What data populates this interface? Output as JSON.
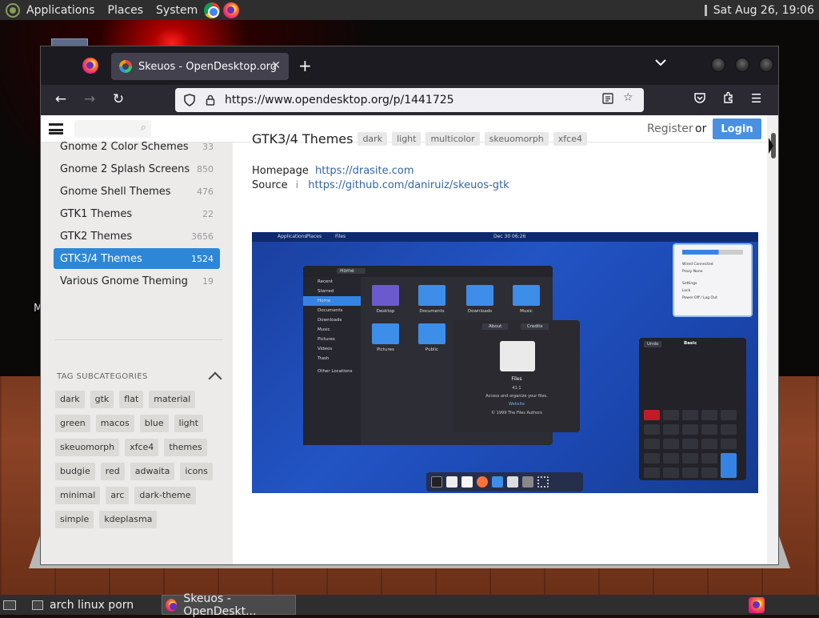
{
  "top_panel": {
    "menus": [
      "Applications",
      "Places",
      "System"
    ],
    "clock": "Sat Aug 26, 19:06"
  },
  "desktop": {
    "label_fragment": "M"
  },
  "browser": {
    "tab_title": "Skeuos - OpenDesktop.org",
    "url": "https://www.opendesktop.org/p/1441725",
    "icons": {
      "back": "back-arrow-icon",
      "forward": "forward-arrow-icon",
      "reload": "reload-icon",
      "shield": "shield-icon",
      "lock": "lock-icon",
      "reader": "reader-view-icon",
      "bookmark": "star-icon",
      "pocket": "pocket-icon",
      "extensions": "puzzle-icon",
      "menu": "hamburger-icon"
    }
  },
  "site": {
    "register": "Register",
    "or": "or",
    "login": "Login"
  },
  "sidebar": {
    "categories": [
      {
        "label": "Gnome 2 Color Schemes",
        "count": "33"
      },
      {
        "label": "Gnome 2 Splash Screens",
        "count": "850"
      },
      {
        "label": "Gnome Shell Themes",
        "count": "476"
      },
      {
        "label": "GTK1 Themes",
        "count": "22"
      },
      {
        "label": "GTK2 Themes",
        "count": "3656"
      },
      {
        "label": "GTK3/4 Themes",
        "count": "1524"
      },
      {
        "label": "Various Gnome Theming",
        "count": "19"
      }
    ],
    "tag_heading": "TAG SUBCATEGORIES",
    "tags": [
      "dark",
      "gtk",
      "flat",
      "material",
      "green",
      "macos",
      "blue",
      "light",
      "skeuomorph",
      "xfce4",
      "themes",
      "budgie",
      "red",
      "adwaita",
      "icons",
      "minimal",
      "arc",
      "dark-theme",
      "simple",
      "kdeplasma"
    ]
  },
  "content": {
    "title": "GTK3/4 Themes",
    "title_tags": [
      "dark",
      "light",
      "multicolor",
      "skeuomorph",
      "xfce4"
    ],
    "homepage_label": "Homepage",
    "homepage_url": "https://drasite.com",
    "source_label": "Source",
    "source_info": "i",
    "source_url": "https://github.com/daniruiz/skeuos-gtk"
  },
  "preview": {
    "topbar": {
      "left1": "Applications",
      "left2": "Places",
      "left3": "Files",
      "center": "Dec 30 06:26"
    },
    "sidebar_items": [
      "Recent",
      "Starred",
      "Home",
      "Documents",
      "Downloads",
      "Music",
      "Pictures",
      "Videos",
      "Trash",
      "Other Locations"
    ],
    "path": "Home",
    "folders": [
      "Desktop",
      "Documents",
      "Downloads",
      "Music",
      "Pictures",
      "Public"
    ],
    "about": {
      "tab1": "About",
      "tab2": "Credits",
      "name": "Files",
      "version": "41.1",
      "desc": "Access and organize your files.",
      "link": "Website",
      "copyright": "© 1999 The Files Authors"
    },
    "quick_settings": [
      "Wired Connected",
      "Proxy None",
      "Settings",
      "Lock",
      "Power Off / Log Out"
    ],
    "calc": {
      "undo": "Undo",
      "mode": "Basic"
    }
  },
  "bottom_panel": {
    "tasks": [
      {
        "label": "arch linux porn"
      },
      {
        "label": "Skeuos - OpenDeskt..."
      }
    ]
  }
}
